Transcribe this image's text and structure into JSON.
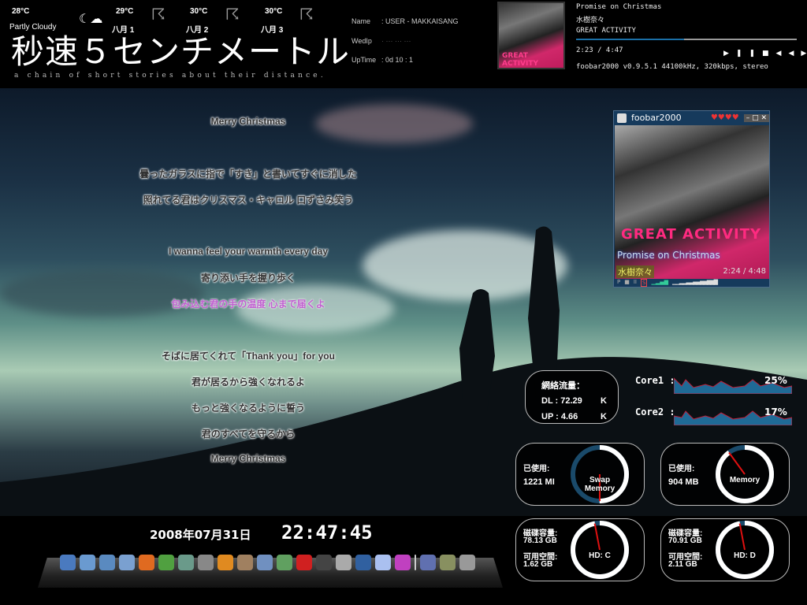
{
  "weather": {
    "current": {
      "temp": "28°C",
      "condition": "Partly Cloudy",
      "icon": "moon-cloud-icon"
    },
    "forecast": [
      {
        "temp": "29°C",
        "day": "八月 1",
        "icon": "thunderstorm-icon"
      },
      {
        "temp": "30°C",
        "day": "八月 2",
        "icon": "thunderstorm-icon"
      },
      {
        "temp": "30°C",
        "day": "八月 3",
        "icon": "thunderstorm-icon"
      }
    ]
  },
  "title": {
    "main": "秒速５センチメートル",
    "subtitle": "a chain of short stories about their distance."
  },
  "sysinfo": {
    "name_label": "Name",
    "name_value": ": USER - MAKKAISANG",
    "ip_label": "WedIp",
    "ip_value": "· ··· ··· ···",
    "uptime_label": "UpTime",
    "uptime_value": ": 0d 10 : 1"
  },
  "nowplaying": {
    "track": "Promise on Christmas",
    "artist": "水樹奈々",
    "album": "GREAT ACTIVITY",
    "time": "2:23 / 4:47",
    "progress": 0.49,
    "codec": "foobar2000 v0.9.5.1 44100kHz, 320kbps, stereo"
  },
  "mini_player": {
    "title": "foobar2000",
    "track": "Promise on Christmas",
    "artist": "水樹奈々",
    "time": "2:24 / 4:48",
    "album_art_text": "GREAT ACTIVITY",
    "rating": 4,
    "buttons": [
      "P",
      "■",
      "II",
      "S"
    ]
  },
  "lyrics": [
    {
      "text": "Merry Christmas",
      "hl": false
    },
    {
      "text": "曇ったガラスに指で「すき」と書いてすぐに消した",
      "hl": false
    },
    {
      "text": "照れてる君はクリスマス・キャロル 口ずさみ笑う",
      "hl": false
    },
    {
      "text": "I wanna feel your warmth every day",
      "hl": false
    },
    {
      "text": "寄り添い手を握り歩く",
      "hl": false
    },
    {
      "text": "包み込む君の手の温度 心まで届くよ",
      "hl": true
    },
    {
      "text": "そばに居てくれて「Thank you」for you",
      "hl": false
    },
    {
      "text": "君が居るから強くなれるよ",
      "hl": false
    },
    {
      "text": "もっと強くなるように誓う",
      "hl": false
    },
    {
      "text": "君のすべてを守るから",
      "hl": false
    },
    {
      "text": "Merry Christmas",
      "hl": false
    }
  ],
  "network": {
    "title": "網絡流量：",
    "dl_label": "DL : 72.29",
    "dl_unit": "K",
    "up_label": "UP : 4.66",
    "up_unit": "K"
  },
  "cpu": [
    {
      "label": "Core1 :",
      "value": "25%"
    },
    {
      "label": "Core2 :",
      "value": "17%"
    }
  ],
  "memory": [
    {
      "used_label": "已使用:",
      "used": "1221 MI",
      "name": "Swap Memory",
      "fraction": 0.5
    },
    {
      "used_label": "已使用:",
      "used": "904 MB",
      "name": "Memory",
      "fraction": 0.9
    }
  ],
  "disks": [
    {
      "cap_label": "磁碟容量:",
      "cap": "78.13 GB",
      "free_label": "可用空間:",
      "free": "1.62 GB",
      "name": "HD: C",
      "fraction": 0.97
    },
    {
      "cap_label": "磁碟容量:",
      "cap": "70.91 GB",
      "free_label": "可用空間:",
      "free": "2.11 GB",
      "name": "HD: D",
      "fraction": 0.97
    }
  ],
  "clock": {
    "date": "2008年07月31日",
    "time": "22:47:45"
  },
  "dock": [
    "my-computer",
    "folder",
    "folder-music",
    "folder-pictures",
    "firefox",
    "msn-messenger",
    "eye",
    "alien",
    "vlc",
    "tool",
    "xfire",
    "network",
    "wings",
    "avatar",
    "counter-strike",
    "linux",
    "butterfly",
    "funnel",
    "separator",
    "wallpaper",
    "orb",
    "usb"
  ],
  "colors": {
    "accent": "#1a6fa6",
    "graph_line": "#c0203a",
    "lyric_highlight": "#c060d0"
  }
}
